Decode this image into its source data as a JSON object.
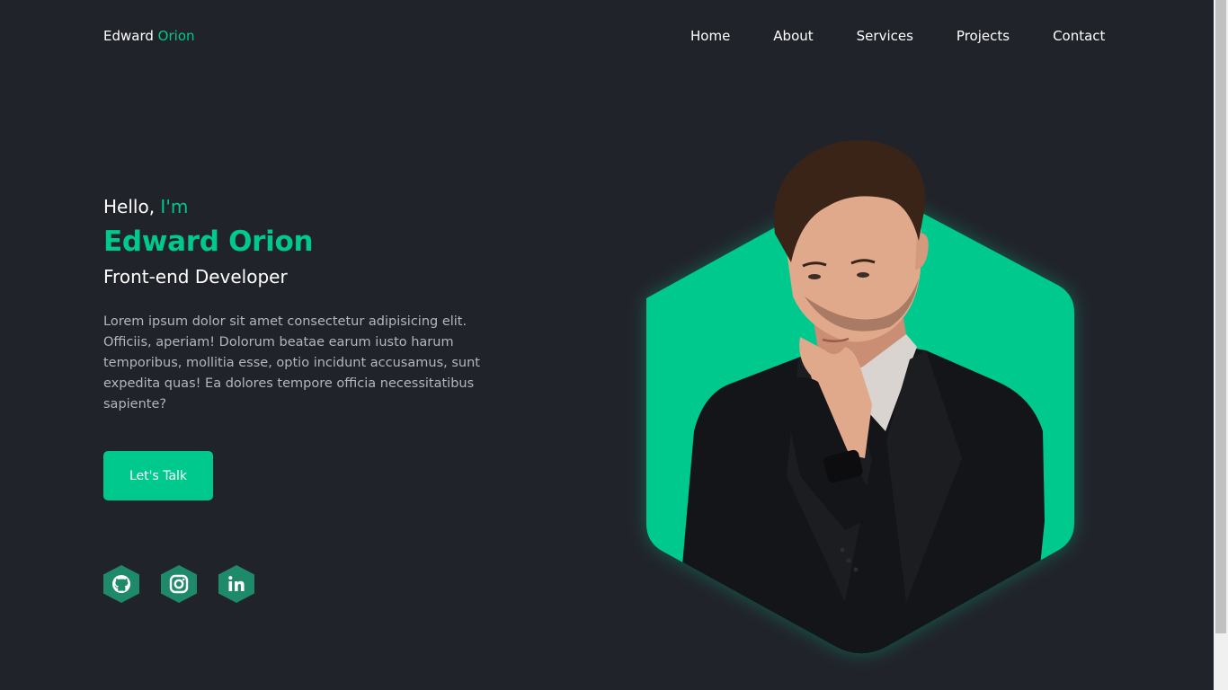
{
  "header": {
    "logo_first": "Edward",
    "logo_second": "Orion",
    "nav": [
      {
        "label": "Home"
      },
      {
        "label": "About"
      },
      {
        "label": "Services"
      },
      {
        "label": "Projects"
      },
      {
        "label": "Contact"
      }
    ]
  },
  "hero": {
    "greeting": "Hello,",
    "greeting_accent": "I'm",
    "name": "Edward Orion",
    "role": "Front-end Developer",
    "description": "Lorem ipsum dolor sit amet consectetur adipisicing elit. Officiis, aperiam! Dolorum beatae earum iusto harum temporibus, mollitia esse, optio incidunt accusamus, sunt expedita quas! Ea dolores tempore officia necessitatibus sapiente?",
    "cta_label": "Let's Talk"
  },
  "socials": [
    {
      "icon": "github-icon"
    },
    {
      "icon": "instagram-icon"
    },
    {
      "icon": "linkedin-icon"
    }
  ],
  "colors": {
    "background": "#21232b",
    "accent": "#00c98d",
    "social_bg": "#1f8a6a",
    "text": "#ffffff",
    "muted_text": "#b3b6bd"
  }
}
